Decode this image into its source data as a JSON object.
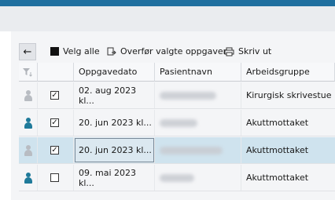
{
  "toolbar": {
    "select_all": "Velg alle",
    "transfer": "Overfør valgte oppgaver",
    "print": "Skriv ut"
  },
  "columns": {
    "date": "Oppgavedato",
    "patient": "Pasientnavn",
    "group": "Arbeidsgruppe"
  },
  "rows": [
    {
      "checked": true,
      "person_color": "#b8bcc2",
      "date": "02. aug 2023 kl...",
      "group": "Kirurgisk skrivestue"
    },
    {
      "checked": true,
      "person_color": "#1f7a9a",
      "date": "20. jun 2023 kl...",
      "group": "Akuttmottaket"
    },
    {
      "checked": true,
      "person_color": "#b8bcc2",
      "date": "20. jun 2023 kl...",
      "group": "Akuttmottaket"
    },
    {
      "checked": false,
      "person_color": "#1f7a9a",
      "date": "09. mai 2023 kl...",
      "group": "Akuttmottaket"
    }
  ],
  "colors": {
    "accent": "#1f6f9f",
    "selected_row": "#cfe3ee"
  }
}
